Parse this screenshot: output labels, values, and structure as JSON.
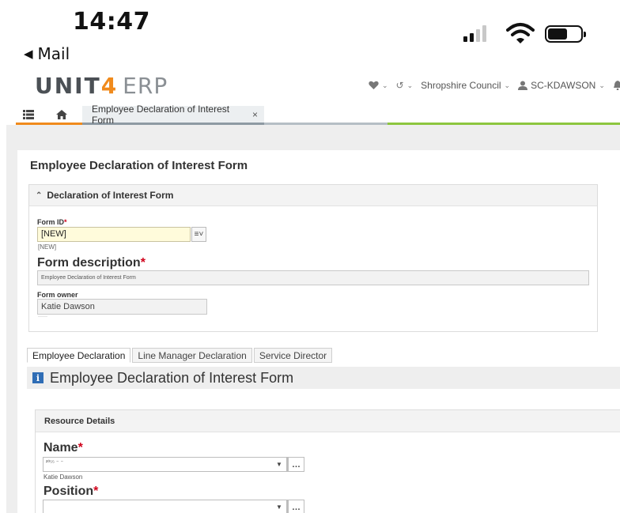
{
  "status_bar": {
    "time": "14:47",
    "back_label": "Mail"
  },
  "app": {
    "logo_left": "UNIT",
    "logo_four": "4",
    "logo_product": "ERP",
    "company": "Shropshire Council",
    "user": "SC-KDAWSON"
  },
  "tabs": {
    "open_tab": "Employee Declaration of Interest Form"
  },
  "form": {
    "page_title": "Employee Declaration of Interest Form",
    "panel_title": "Declaration of Interest Form",
    "form_id_label": "Form ID",
    "form_id_value": "[NEW]",
    "form_id_sub": "[NEW]",
    "description_label": "Form description",
    "description_value": "Employee Declaration of Interest Form",
    "owner_label": "Form owner",
    "owner_value": "Katie Dawson"
  },
  "subtabs": [
    {
      "label": "Employee Declaration",
      "active": true
    },
    {
      "label": "Line Manager Declaration",
      "active": false
    },
    {
      "label": "Service Director",
      "active": false
    }
  ],
  "section": {
    "title": "Employee Declaration of Interest Form",
    "resource_panel_title": "Resource Details",
    "name_label": "Name",
    "name_sub": "Katie Dawson",
    "position_label": "Position"
  },
  "colors": {
    "accent_orange": "#f08a1c",
    "accent_green": "#8dc63f",
    "info_blue": "#2f6db5",
    "required_red": "#d0021b"
  }
}
